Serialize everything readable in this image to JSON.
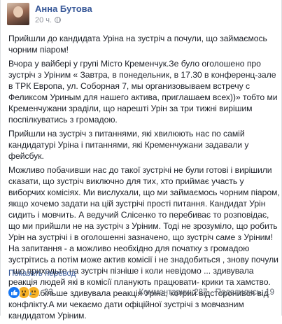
{
  "post": {
    "author": "Анна Бутова",
    "time": "20 ч.",
    "paragraphs": [
      "Прийшли до кандидата Уріна на зустріч а почули, що займаємось чорним піаром!",
      "Вчора у вайбері у групі Місто Кременчук.Зе було оголошено про зустріч з Уріним « Завтра, в понедельник, в 17.30 в конференц-зале в ТРК Европа, ул. Соборная 7, мы организовываем встречу с Феликсом Уриным для нашего актива, приглашаем всех))» тобто ми Кременчужани зраділи, що нарешті Урін за три тижні вирішим поспілкуватись з громадою.",
      "Прийшли на зустріч з питаннями, які хвилюють нас по самій кандидатурі Уріна і питаннями, які Кременчужани задавали у фейсбук.",
      "Можливо побачивши нас до такої зустрічі не були готові і вирішили сказати, що зустріч виключно для тих, хто приймає участь у виборчих комісіях. Ми вислухали, що ми займаємось чорним піаром, якщо хочемо задати на цій зустрічі прості питання. Кандидат Урін сидить і мовчить. А ведучий Слісенко то перебиває то розповідає, що ми прийшли не на зустріч з Уріним. Тоді не зрозуміло, що робить Урін на зустрічі і в оголошенні зазначено, що зустріч саме з Уріним! На запитання - а можливо необхідно для початку з громадою зустрітись а потім може актив комісії і не знадобиться , знову почули , що приходьте на зустріч пізніше і коли невідомо ... здивувала реакція людей які в комісії планують працювати- крики та хамство. Але найбільше здивувала реакція Уріна, котрий відсторонився від конфлікту.А ми чекаємо дати офіційної зустрічі з мовчазним кандидатом Уріним."
    ],
    "see_translation": "Показать перевод"
  },
  "footer": {
    "reactions": [
      "like-icon",
      "wow-icon",
      "sad-icon"
    ],
    "reaction_count": "33",
    "comments": "Комментарии: 287",
    "shares": "Поделились: 19"
  }
}
